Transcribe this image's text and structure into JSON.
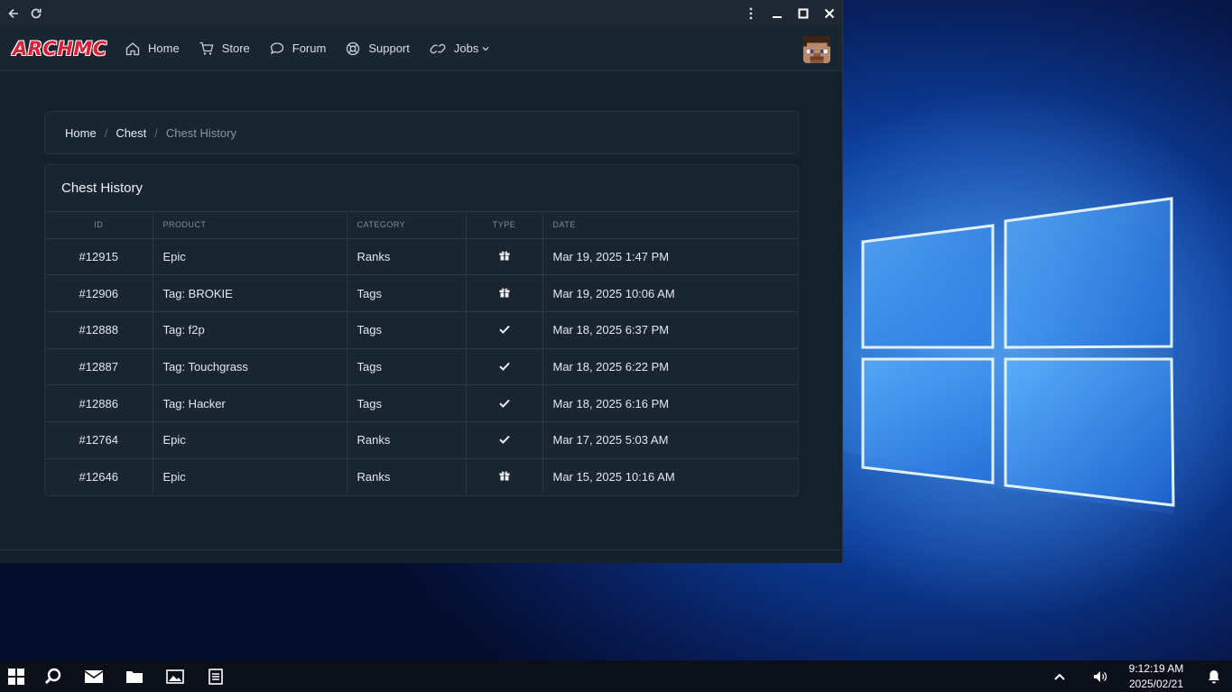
{
  "browser": {
    "back_icon": "arrow-left-icon",
    "reload_icon": "reload-icon",
    "menu_icon": "kebab-menu-icon",
    "minimize_icon": "minimize-icon",
    "maximize_icon": "maximize-icon",
    "close_icon": "close-icon"
  },
  "site": {
    "logo_text": "ARCHMC",
    "nav": [
      {
        "label": "Home",
        "icon": "house-icon"
      },
      {
        "label": "Store",
        "icon": "cart-icon"
      },
      {
        "label": "Forum",
        "icon": "chat-bubble-icon"
      },
      {
        "label": "Support",
        "icon": "lifebuoy-icon"
      },
      {
        "label": "Jobs",
        "icon": "link-icon",
        "has_dropdown": true
      }
    ],
    "avatar": "minecraft-steve-avatar"
  },
  "breadcrumb": {
    "items": [
      "Home",
      "Chest",
      "Chest History"
    ],
    "separator": "/"
  },
  "history": {
    "title": "Chest History",
    "columns": [
      "ID",
      "PRODUCT",
      "CATEGORY",
      "TYPE",
      "DATE"
    ],
    "rows": [
      {
        "id": "#12915",
        "product": "Epic",
        "category": "Ranks",
        "type": "gift",
        "date": "Mar 19, 2025 1:47 PM"
      },
      {
        "id": "#12906",
        "product": "Tag: BROKIE",
        "category": "Tags",
        "type": "gift",
        "date": "Mar 19, 2025 10:06 AM"
      },
      {
        "id": "#12888",
        "product": "Tag: f2p",
        "category": "Tags",
        "type": "check",
        "date": "Mar 18, 2025 6:37 PM"
      },
      {
        "id": "#12887",
        "product": "Tag: Touchgrass",
        "category": "Tags",
        "type": "check",
        "date": "Mar 18, 2025 6:22 PM"
      },
      {
        "id": "#12886",
        "product": "Tag: Hacker",
        "category": "Tags",
        "type": "check",
        "date": "Mar 18, 2025 6:16 PM"
      },
      {
        "id": "#12764",
        "product": "Epic",
        "category": "Ranks",
        "type": "check",
        "date": "Mar 17, 2025 5:03 AM"
      },
      {
        "id": "#12646",
        "product": "Epic",
        "category": "Ranks",
        "type": "gift",
        "date": "Mar 15, 2025 10:16 AM"
      }
    ]
  },
  "taskbar": {
    "apps": [
      "windows-start-icon",
      "search-icon",
      "mail-icon",
      "folder-icon",
      "photos-icon",
      "document-icon"
    ],
    "tray": [
      "chevron-up-icon",
      "volume-icon",
      "notification-bell-icon"
    ],
    "time": "9:12:19 AM",
    "date": "2025/02/21"
  },
  "colors": {
    "page_bg": "#15202d",
    "card_bg": "#1a2532",
    "logo_red": "#d8203a"
  }
}
